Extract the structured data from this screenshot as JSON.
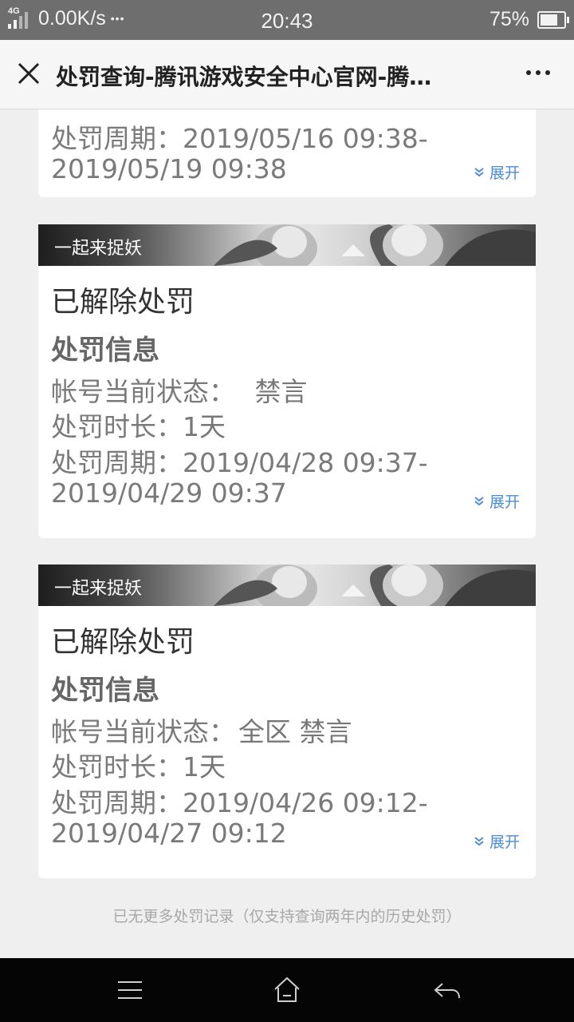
{
  "status_bar": {
    "network": "4G",
    "speed": "0.00K/s",
    "dots": "•••",
    "time": "20:43",
    "battery": "75%",
    "battery_level": 0.75
  },
  "title_bar": {
    "title": "处罚查询-腾讯游戏安全中心官网-腾…"
  },
  "partial_card": {
    "period_label": "处罚周期：",
    "period_start": "2019/05/16 09:38-",
    "period_end": "2019/05/19 09:38",
    "expand_label": "展开"
  },
  "cards": [
    {
      "game": "一起来捉妖",
      "status": "已解除处罚",
      "section_title": "处罚信息",
      "account_status_label": "帐号当前状态：",
      "account_status_value": "禁言",
      "duration_label": "处罚时长：",
      "duration_value": "1天",
      "period_label": "处罚周期：",
      "period_start": "2019/04/28 09:37-",
      "period_end": "2019/04/29 09:37",
      "expand_label": "展开"
    },
    {
      "game": "一起来捉妖",
      "status": "已解除处罚",
      "section_title": "处罚信息",
      "account_status_label": "帐号当前状态：",
      "account_status_value": "全区 禁言",
      "duration_label": "处罚时长：",
      "duration_value": "1天",
      "period_label": "处罚周期：",
      "period_start": "2019/04/26 09:12-",
      "period_end": "2019/04/27 09:12",
      "expand_label": "展开"
    }
  ],
  "footer_note": "已无更多处罚记录（仅支持查询两年内的历史处罚）",
  "colors": {
    "link": "#4c8bd8",
    "background": "#efefef",
    "status_bar": "#6e6e6e",
    "nav_bar": "#050505"
  },
  "icons": {
    "close": "close-icon",
    "more": "more-dots-icon",
    "expand": "chevron-double-down-icon",
    "nav_menu": "menu-icon",
    "nav_home": "home-icon",
    "nav_back": "back-icon"
  }
}
